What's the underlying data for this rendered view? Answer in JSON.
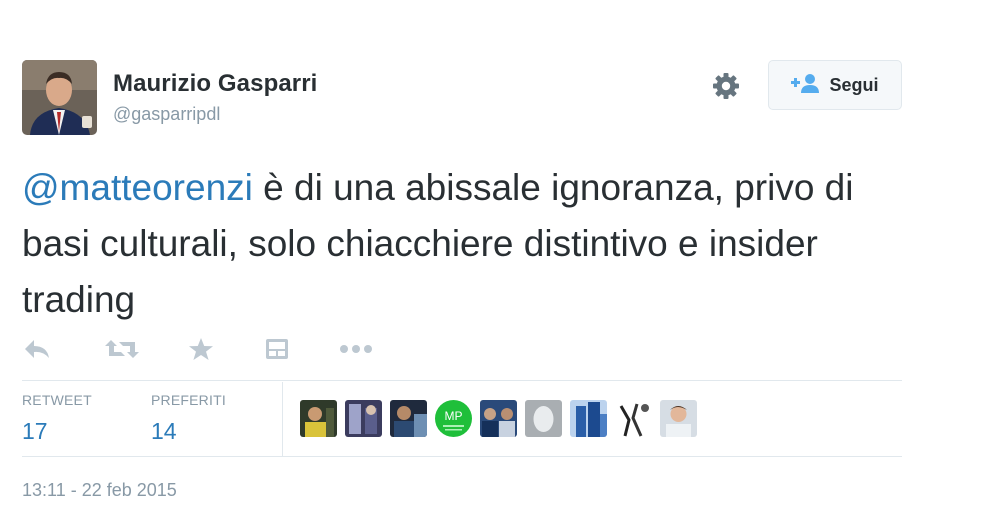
{
  "header": {
    "display_name": "Maurizio Gasparri",
    "handle": "@gasparripdl",
    "follow_label": "Segui"
  },
  "tweet": {
    "mention": "@matteorenzi",
    "text_after_mention": " è di una abissale ignoranza, privo di basi culturali, solo chiacchiere distintivo e insider trading"
  },
  "icons": [
    "reply-icon",
    "retweet-icon",
    "favorite-icon",
    "card-icon",
    "more-icon",
    "gear-icon",
    "follow-user-icon"
  ],
  "stats": {
    "retweet_label": "RETWEET",
    "retweet_count": "17",
    "favorites_label": "PREFERITI",
    "favorites_count": "14"
  },
  "faces": {
    "mp_label": "MP"
  },
  "timestamp": "13:11 - 22 feb 2015",
  "colors": {
    "link": "#2b7bb9",
    "muted": "#8899a6",
    "text": "#292f33",
    "border": "#e1e8ed"
  }
}
